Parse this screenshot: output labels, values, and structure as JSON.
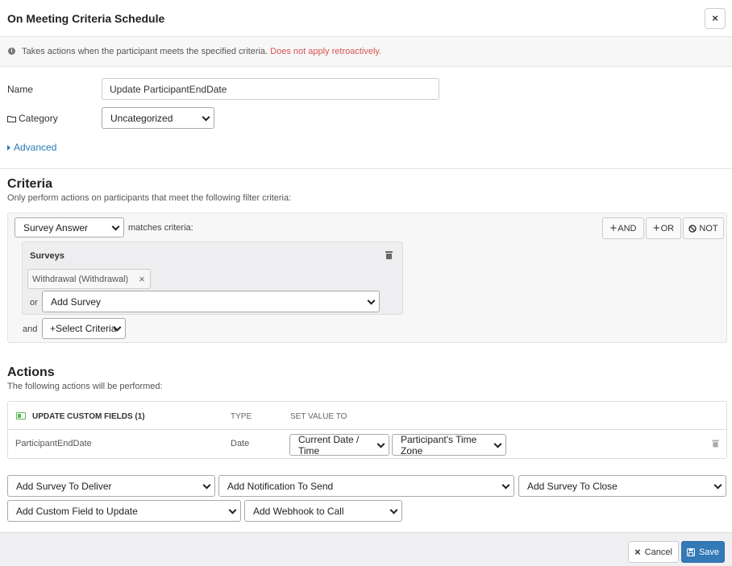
{
  "modal": {
    "title": "On Meeting Criteria Schedule",
    "close_label": "×"
  },
  "info": {
    "icon": "info-circle-icon",
    "text": "Takes actions when the participant meets the specified criteria.",
    "warning": "Does not apply retroactively."
  },
  "general": {
    "name_label": "Name",
    "name_value": "Update ParticipantEndDate",
    "category_label": "Category",
    "category_value": "Uncategorized",
    "advanced_label": "Advanced"
  },
  "criteria": {
    "heading": "Criteria",
    "subtext": "Only perform actions on participants that meet the following filter criteria:",
    "type_select": "Survey Answer",
    "matches_label": "matches criteria:",
    "and_btn": "AND",
    "or_btn": "OR",
    "not_btn": "NOT",
    "surveys_title": "Surveys",
    "survey_tag": "Withdrawal (Withdrawal)",
    "or_label": "or",
    "add_survey": "Add Survey",
    "and_label": "and",
    "select_criteria": "+Select Criteria"
  },
  "actions": {
    "heading": "Actions",
    "subtext": "The following actions will be performed:",
    "table": {
      "title": "UPDATE CUSTOM FIELDS (1)",
      "col_type": "TYPE",
      "col_set": "SET VALUE TO",
      "rows": [
        {
          "field": "ParticipantEndDate",
          "type": "Date",
          "value": "Current Date / Time",
          "timezone": "Participant's Time Zone"
        }
      ]
    },
    "add_survey_deliver": "Add Survey To Deliver",
    "add_notification": "Add Notification To Send",
    "add_survey_close": "Add Survey To Close",
    "add_custom_field": "Add Custom Field to Update",
    "add_webhook": "Add Webhook to Call"
  },
  "footer": {
    "cancel": "Cancel",
    "save": "Save"
  },
  "colors": {
    "link": "#2a7ab5",
    "warning": "#d9534f",
    "primary": "#337ab7",
    "success": "#5cb85c"
  }
}
